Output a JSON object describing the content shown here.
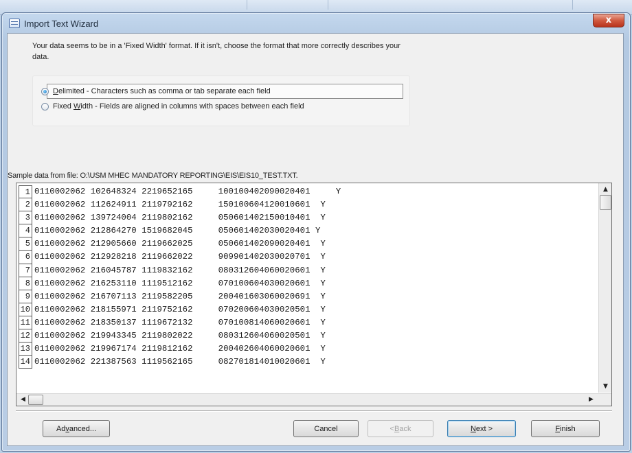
{
  "window": {
    "title": "Import Text Wizard",
    "close_glyph": "x"
  },
  "intro_text": "Your data seems to be in a 'Fixed Width' format. If it isn't, choose the format that more correctly describes your data.",
  "format_options": [
    {
      "pre": "",
      "key": "D",
      "rest": "elimited - Characters such as comma or tab separate each field",
      "selected": true
    },
    {
      "pre": "Fixed ",
      "key": "W",
      "rest": "idth - Fields are aligned in columns with spaces between each field",
      "selected": false
    }
  ],
  "sample_label": "Sample data from file: O:\\USM MHEC MANDATORY REPORTING\\EIS\\EIS10_TEST.TXT.",
  "sample_rows": [
    {
      "num": "1",
      "text": "0110002062 102648324 2219652165     100100402090020401     Y"
    },
    {
      "num": "2",
      "text": "0110002062 112624911 2119792162     150100604120010601  Y"
    },
    {
      "num": "3",
      "text": "0110002062 139724004 2119802162     050601402150010401  Y"
    },
    {
      "num": "4",
      "text": "0110002062 212864270 1519682045     050601402030020401 Y"
    },
    {
      "num": "5",
      "text": "0110002062 212905660 2119662025     050601402090020401  Y"
    },
    {
      "num": "6",
      "text": "0110002062 212928218 2119662022     909901402030020701  Y"
    },
    {
      "num": "7",
      "text": "0110002062 216045787 1119832162     080312604060020601  Y"
    },
    {
      "num": "8",
      "text": "0110002062 216253110 1119512162     070100604030020601  Y"
    },
    {
      "num": "9",
      "text": "0110002062 216707113 2119582205     200401603060020691  Y"
    },
    {
      "num": "10",
      "text": "0110002062 218155971 2119752162     070200604030020501  Y"
    },
    {
      "num": "11",
      "text": "0110002062 218350137 1119672132     070100814060020601  Y"
    },
    {
      "num": "12",
      "text": "0110002062 219943345 2119802022     080312604060020501  Y"
    },
    {
      "num": "13",
      "text": "0110002062 219967174 2119812162     200402604060020601  Y"
    },
    {
      "num": "14",
      "text": "0110002062 221387563 1119562165     082701814010020601  Y"
    }
  ],
  "scroll": {
    "up": "▲",
    "down": "▼",
    "left": "◀",
    "right": "▶"
  },
  "buttons": {
    "advanced": {
      "pre": "Ad",
      "key": "v",
      "rest": "anced..."
    },
    "cancel": {
      "pre": "",
      "key": "",
      "rest": "Cancel"
    },
    "back": {
      "pre": "< ",
      "key": "B",
      "rest": "ack"
    },
    "next": {
      "pre": "",
      "key": "N",
      "rest": "ext >"
    },
    "finish": {
      "pre": "",
      "key": "F",
      "rest": "inish"
    }
  }
}
